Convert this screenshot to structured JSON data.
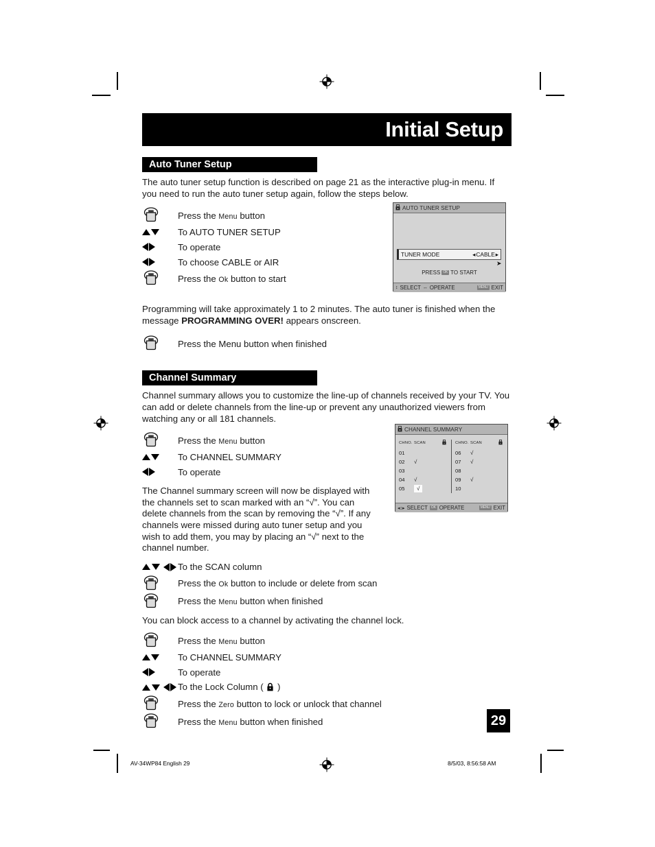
{
  "page": {
    "title": "Initial Setup",
    "number": "29"
  },
  "sections": [
    {
      "heading": "Auto Tuner Setup",
      "intro": "The auto tuner setup function is described on page 21 as the interactive plug-in menu.  If you need to run the auto tuner setup again, follow the steps below.",
      "steps": [
        {
          "icon": "hand-press-button-icon",
          "text_pre": "Press the ",
          "text_sc": "Menu",
          "text_post": " button"
        },
        {
          "icon": "up-down-arrows-icon",
          "text": "To AUTO TUNER SETUP"
        },
        {
          "icon": "left-right-arrows-icon",
          "text": "To operate"
        },
        {
          "icon": "left-right-arrows-icon",
          "text": "To choose CABLE or AIR"
        },
        {
          "icon": "hand-press-button-icon",
          "text_pre": "Press the ",
          "text_sc": "Ok",
          "text_post": " button to start"
        }
      ],
      "note_pre": "Programming will take approximately 1 to 2 minutes.  The auto tuner is finished when the message ",
      "note_bold": "PROGRAMMING OVER!",
      "note_post": " appears onscreen.",
      "final_step": {
        "icon": "hand-press-button-icon",
        "text": "Press the Menu button when finished"
      }
    },
    {
      "heading": "Channel Summary",
      "intro": "Channel summary allows you to customize the line-up of channels received by your TV. You can add or delete channels from the line-up or prevent any unauthorized viewers from watching any or all 181 channels.",
      "steps": [
        {
          "icon": "hand-press-button-icon",
          "text_pre": "Press the ",
          "text_sc": "Menu",
          "text_post": " button"
        },
        {
          "icon": "up-down-arrows-icon",
          "text": "To CHANNEL SUMMARY"
        },
        {
          "icon": "left-right-arrows-icon",
          "text": "To operate"
        }
      ],
      "paragraph2": "The Channel summary screen will now be displayed with the channels set to scan marked with an “√”. You can delete channels from the scan by removing the “√”. If any channels were missed during auto tuner setup and you wish to add them, you may by placing an “√” next to the channel number.",
      "steps2": [
        {
          "icon": "up-down-left-right-arrows-icon",
          "text": "To the SCAN column"
        },
        {
          "icon": "hand-press-button-icon",
          "text_pre": "Press the ",
          "text_sc": "Ok",
          "text_post": " button to include or delete from scan"
        },
        {
          "icon": "hand-press-button-icon",
          "text_pre": "Press the ",
          "text_sc": "Menu",
          "text_post": " button when finished"
        }
      ],
      "paragraph3": "You can block access to a channel by activating the channel lock.",
      "steps3": [
        {
          "icon": "hand-press-button-icon",
          "text_pre": "Press the ",
          "text_sc": "Menu",
          "text_post": " button"
        },
        {
          "icon": "up-down-arrows-icon",
          "text": "To CHANNEL SUMMARY"
        },
        {
          "icon": "left-right-arrows-icon",
          "text": "To operate"
        },
        {
          "icon": "up-down-left-right-arrows-icon",
          "text_pre": "To the Lock Column ( ",
          "text_post": " )"
        },
        {
          "icon": "hand-press-button-icon",
          "text_pre": "Press the ",
          "text_sc": "Zero",
          "text_post": " button to lock or unlock that channel"
        },
        {
          "icon": "hand-press-button-icon",
          "text_pre": "Press the ",
          "text_sc": "Menu",
          "text_post": " button when finished"
        }
      ]
    }
  ],
  "osd_auto_tuner": {
    "title": "AUTO TUNER SETUP",
    "row_label": "TUNER MODE",
    "row_value": "CABLE",
    "press_start_pre": "PRESS",
    "press_start_key": "OK",
    "press_start_post": "TO START",
    "foot_select": "SELECT",
    "foot_operate": "OPERATE",
    "foot_exit": "EXIT",
    "foot_exit_key": "MENU"
  },
  "osd_channel_summary": {
    "title": "CHANNEL SUMMARY",
    "col_headers": [
      "CHNO.",
      "SCAN",
      "lock-icon"
    ],
    "left_column": [
      {
        "no": "01",
        "scan": "",
        "selected": false
      },
      {
        "no": "02",
        "scan": "√",
        "selected": false
      },
      {
        "no": "03",
        "scan": "",
        "selected": false
      },
      {
        "no": "04",
        "scan": "√",
        "selected": false
      },
      {
        "no": "05",
        "scan": "√",
        "selected": true
      }
    ],
    "right_column": [
      {
        "no": "06",
        "scan": "√",
        "selected": false
      },
      {
        "no": "07",
        "scan": "√",
        "selected": false
      },
      {
        "no": "08",
        "scan": "",
        "selected": false
      },
      {
        "no": "09",
        "scan": "√",
        "selected": false
      },
      {
        "no": "10",
        "scan": "",
        "selected": false
      }
    ],
    "foot_select": "SELECT",
    "foot_operate": "OPERATE",
    "foot_operate_key": "OK",
    "foot_exit": "EXIT",
    "foot_exit_key": "MENU"
  },
  "footer": {
    "left": "AV-34WP84 English   29",
    "right": "8/5/03, 8:56:58 AM"
  },
  "colors": {
    "banner": "#000000",
    "osd_bg": "#d4d4d4",
    "osd_bar": "#b4b4b4"
  }
}
